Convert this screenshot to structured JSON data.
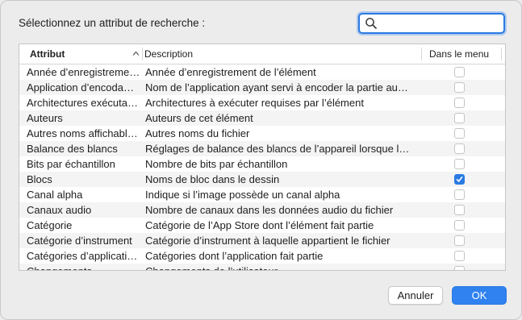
{
  "dialog": {
    "prompt": "Sélectionnez un attribut de recherche :",
    "search": {
      "value": "",
      "placeholder": ""
    }
  },
  "table": {
    "headers": {
      "attribute": "Attribut",
      "description": "Description",
      "in_menu": "Dans le menu"
    },
    "rows": [
      {
        "attribute": "Année d’enregistreme…",
        "description": "Année d’enregistrement de l’élément",
        "checked": false
      },
      {
        "attribute": "Application d’encoda…",
        "description": "Nom de l’application ayant servi à encoder la partie au…",
        "checked": false
      },
      {
        "attribute": "Architectures exécuta…",
        "description": "Architectures à exécuter requises par l’élément",
        "checked": false
      },
      {
        "attribute": "Auteurs",
        "description": "Auteurs de cet élément",
        "checked": false
      },
      {
        "attribute": "Autres noms affichabl…",
        "description": "Autres noms du fichier",
        "checked": false
      },
      {
        "attribute": "Balance des blancs",
        "description": "Réglages de balance des blancs de l’appareil lorsque l…",
        "checked": false
      },
      {
        "attribute": "Bits par échantillon",
        "description": "Nombre de bits par échantillon",
        "checked": false
      },
      {
        "attribute": "Blocs",
        "description": "Noms de bloc dans le dessin",
        "checked": true
      },
      {
        "attribute": "Canal alpha",
        "description": "Indique si l’image possède un canal alpha",
        "checked": false
      },
      {
        "attribute": "Canaux audio",
        "description": "Nombre de canaux dans les données audio du fichier",
        "checked": false
      },
      {
        "attribute": "Catégorie",
        "description": "Catégorie de l’App Store dont l’élément fait partie",
        "checked": false
      },
      {
        "attribute": "Catégorie d’instrument",
        "description": "Catégorie d’instrument à laquelle appartient le fichier",
        "checked": false
      },
      {
        "attribute": "Catégories d’applicati…",
        "description": "Catégories dont l’application fait partie",
        "checked": false
      },
      {
        "attribute": "Changements…",
        "description": "Changements de l’utilisateur",
        "checked": false
      }
    ]
  },
  "buttons": {
    "cancel": "Annuler",
    "ok": "OK"
  },
  "colors": {
    "accent": "#2f82f0",
    "row_alt": "#f4f4f4",
    "background": "#ececec"
  },
  "icons": {
    "search": "magnifier-icon",
    "sort": "chevron-up-icon",
    "check": "checkmark-icon"
  }
}
